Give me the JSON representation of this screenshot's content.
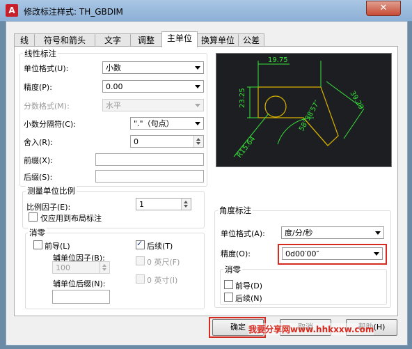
{
  "window": {
    "icon_letter": "A",
    "title": "修改标注样式: TH_GBDIM",
    "close_glyph": "✕"
  },
  "tabs": [
    "线",
    "符号和箭头",
    "文字",
    "调整",
    "主单位",
    "换算单位",
    "公差"
  ],
  "active_tab": "主单位",
  "linear": {
    "group_title": "线性标注",
    "unit_format_label": "单位格式(U):",
    "unit_format_value": "小数",
    "precision_label": "精度(P):",
    "precision_value": "0.00",
    "fraction_label": "分数格式(M):",
    "fraction_value": "水平",
    "decimal_sep_label": "小数分隔符(C):",
    "decimal_sep_value": "\".\"（句点）",
    "round_label": "舍入(R):",
    "round_value": "0",
    "prefix_label": "前缀(X):",
    "suffix_label": "后缀(S):"
  },
  "scale": {
    "group_title": "测量单位比例",
    "factor_label": "比例因子(E):",
    "factor_value": "1",
    "layout_only_label": "仅应用到布局标注"
  },
  "zero_linear": {
    "group_title": "消零",
    "leading_label": "前导(L)",
    "sub_factor_label": "辅单位因子(B):",
    "sub_factor_value": "100",
    "sub_suffix_label": "辅单位后缀(N):",
    "trailing_label": "后续(T)",
    "feet_label": "0 英尺(F)",
    "inches_label": "0 英寸(I)"
  },
  "angular": {
    "group_title": "角度标注",
    "unit_format_label": "单位格式(A):",
    "unit_format_value": "度/分/秒",
    "precision_label": "精度(O):",
    "precision_value": "0d00′00″"
  },
  "zero_angular": {
    "group_title": "消零",
    "leading_label": "前导(D)",
    "trailing_label": "后续(N)"
  },
  "preview": {
    "dim_top": "19.75",
    "dim_left": "23.25",
    "dim_right": "39.29",
    "dim_angle": "58°38′57″",
    "dim_radius": "R15.64"
  },
  "buttons": {
    "ok": "确定",
    "cancel": "取消",
    "help": "帮助(H)"
  },
  "watermark": "我要分享网www.hhkxxw.com",
  "colors": {
    "highlight_red": "#d42a1f",
    "preview_bg": "#1c1e21",
    "preview_dim": "#39e23b",
    "preview_geom": "#d8b300"
  }
}
